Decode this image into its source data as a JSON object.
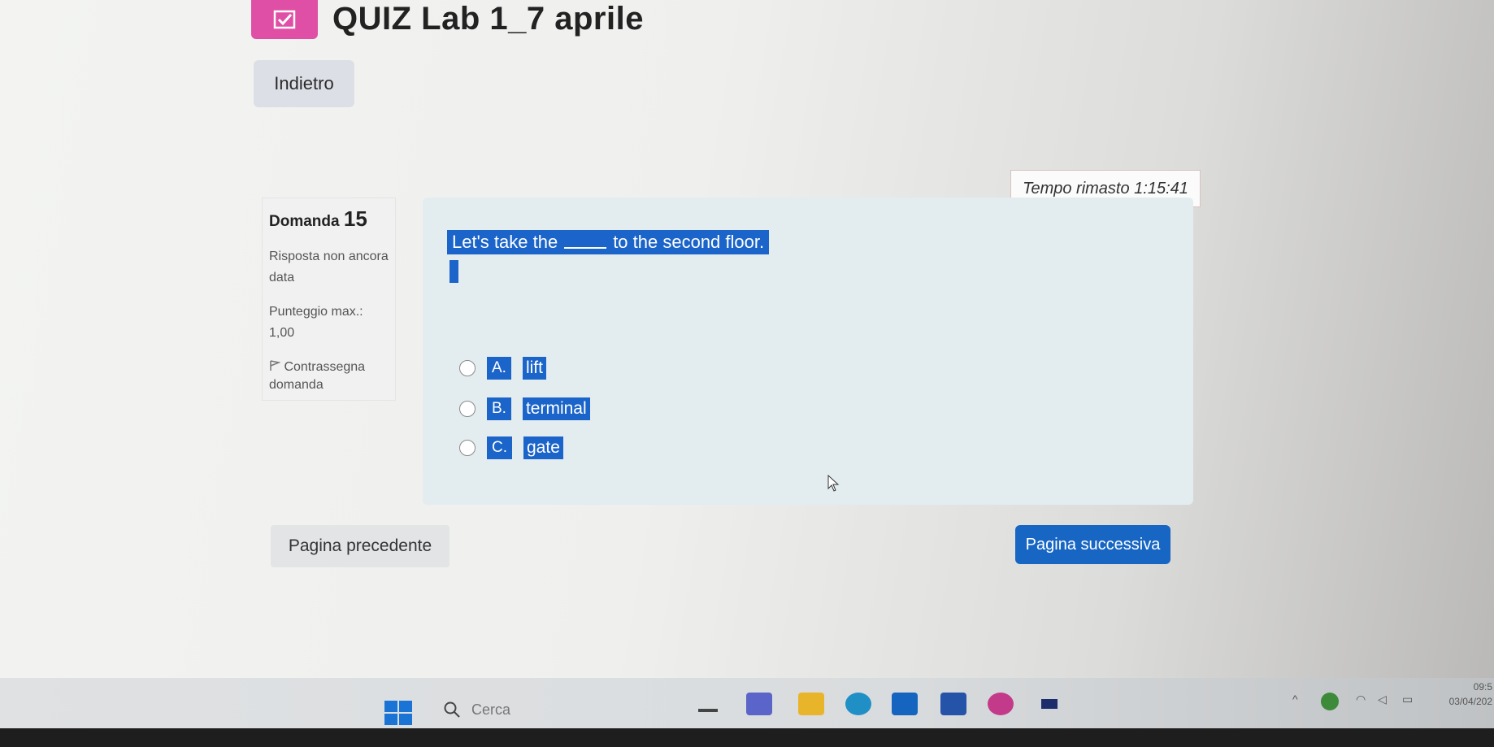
{
  "page": {
    "title": "QUIZ Lab 1_7 aprile",
    "back_label": "Indietro"
  },
  "timer": {
    "label": "Tempo rimasto 1:15:41"
  },
  "question_info": {
    "title_prefix": "Domanda",
    "number": "15",
    "state": "Risposta non ancora data",
    "score": "Punteggio max.: 1,00",
    "flag_label": "Contrassegna domanda"
  },
  "question": {
    "text_before": "Let's take the",
    "text_after": "to the second floor.",
    "options": [
      {
        "letter": "A.",
        "text": "lift"
      },
      {
        "letter": "B.",
        "text": "terminal"
      },
      {
        "letter": "C.",
        "text": "gate"
      }
    ]
  },
  "navigation": {
    "prev_label": "Pagina precedente",
    "next_label": "Pagina successiva"
  },
  "taskbar": {
    "search_label": "Cerca",
    "time": "09:5",
    "date": "03/04/202"
  },
  "colors": {
    "accent": "#1766c4",
    "highlight": "#1b64c9",
    "quiz_icon": "#e04fa6"
  }
}
